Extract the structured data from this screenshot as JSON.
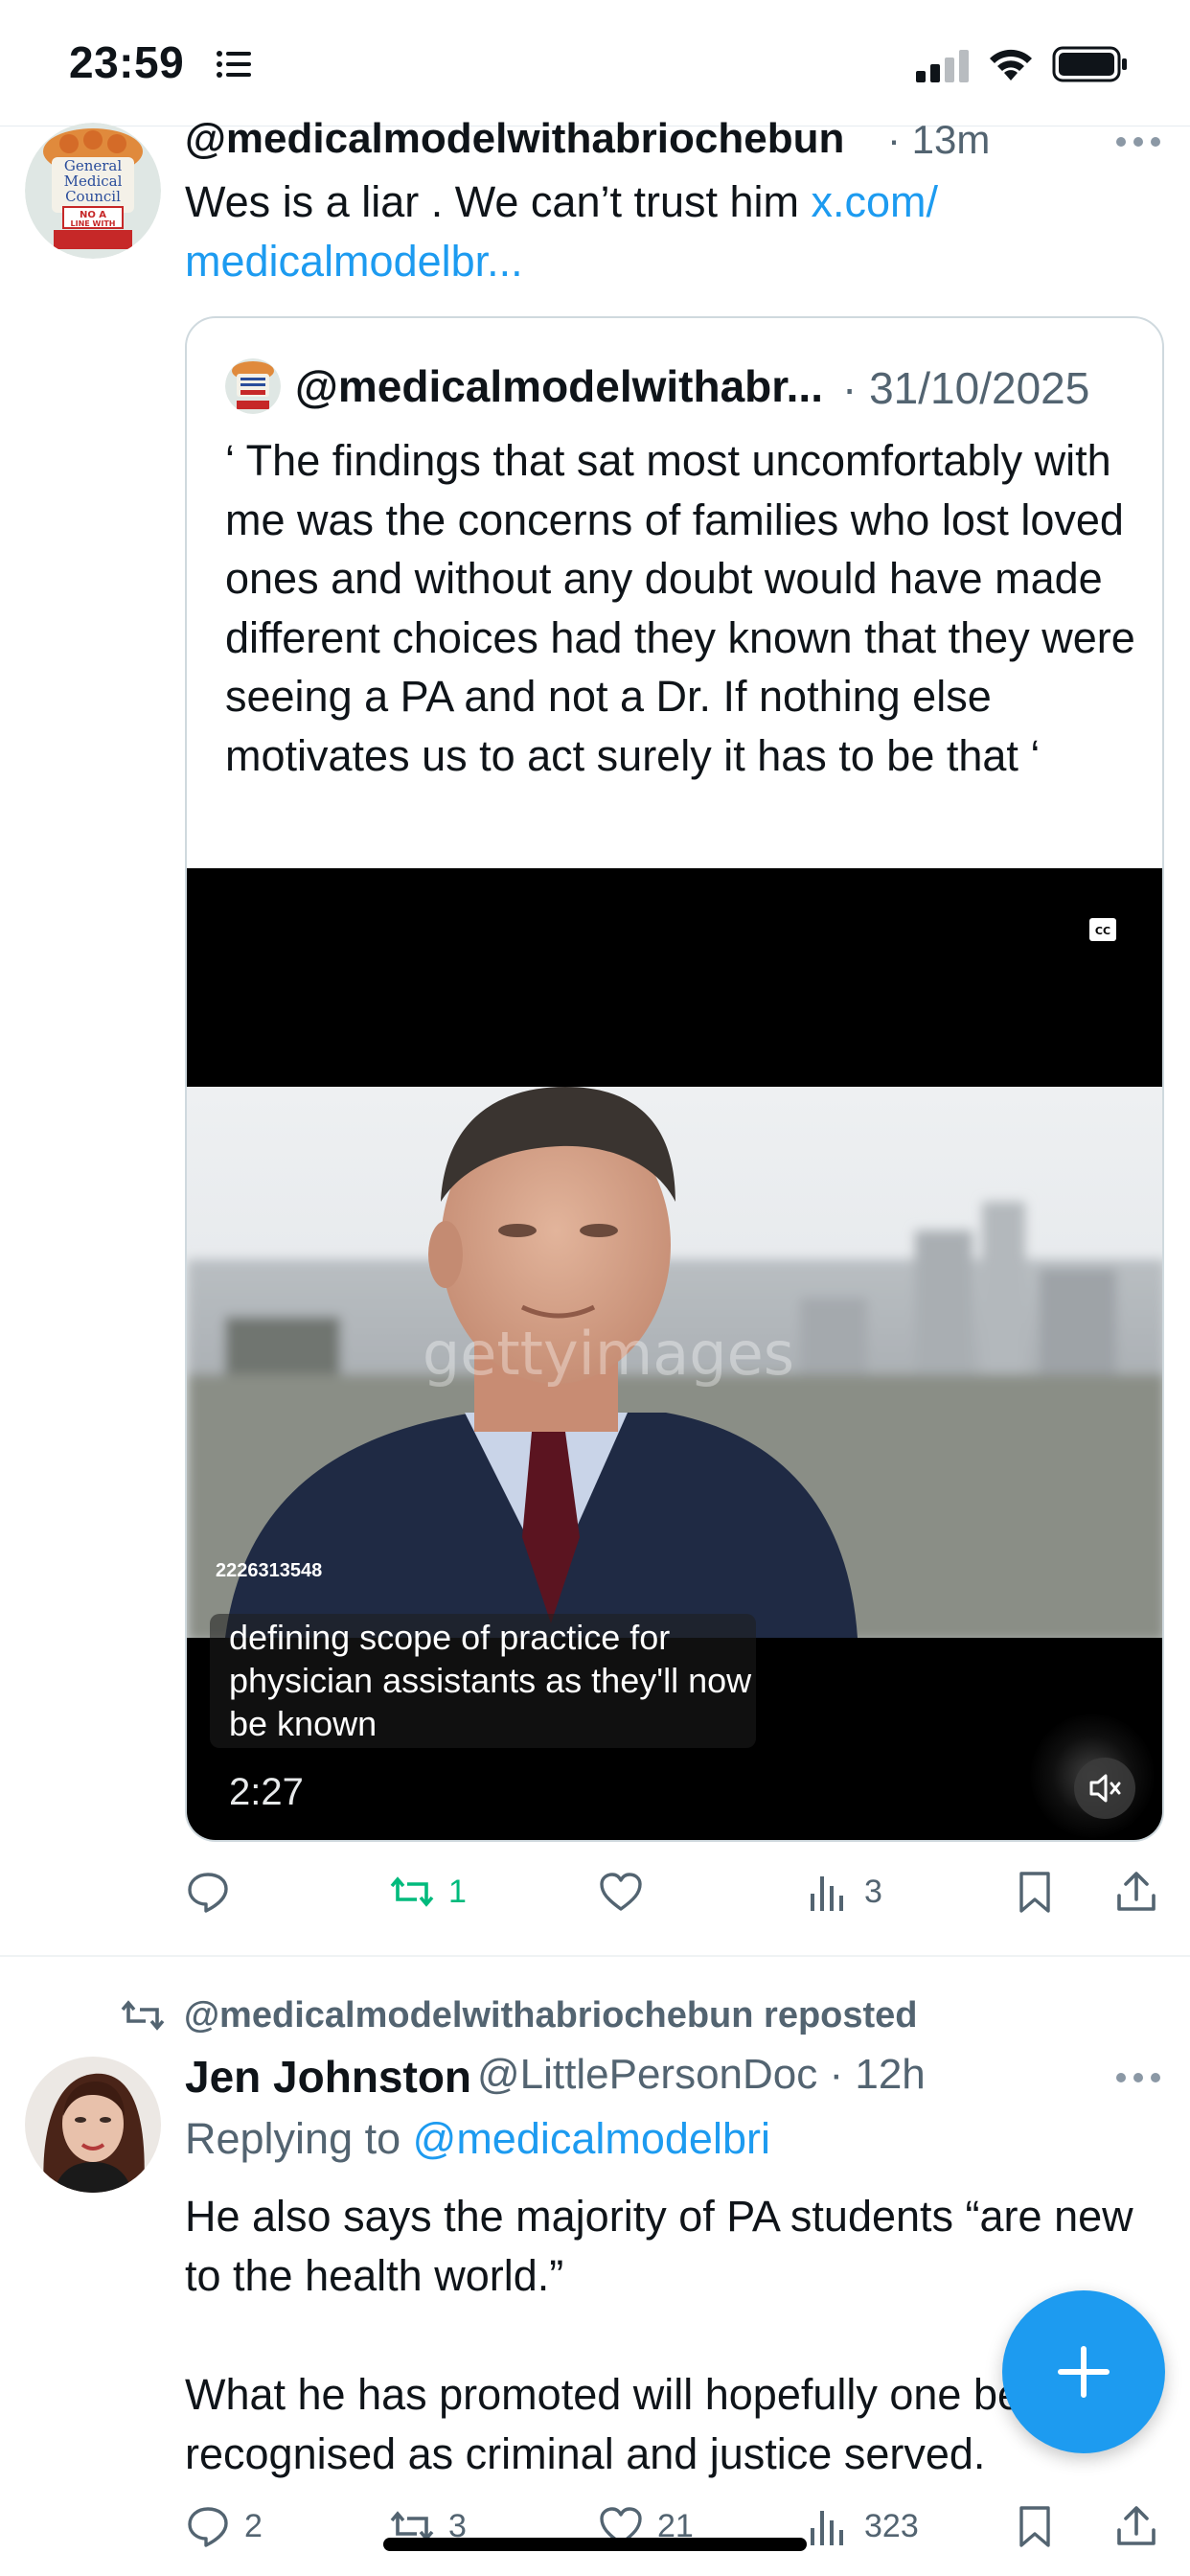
{
  "status_bar": {
    "time": "23:59"
  },
  "tweet1": {
    "handle": "@medicalmodelwithabriochebun",
    "time": "· 13m",
    "text": "Wes is a liar . We can’t trust him ",
    "link": "x.com/ medicalmodelbr...",
    "avatar_text": [
      "General",
      "Medical",
      "Council",
      "NO A",
      "LINE WITH"
    ],
    "quote": {
      "handle": "@medicalmodelwithabr...",
      "date": "· 31/10/2025",
      "text": "‘ The findings that sat most uncomfortably with me was the concerns of families who lost loved ones and without any doubt would have made different choices had they known that they were seeing a PA and not a Dr. If nothing else motivates us to act surely it has to be that ‘",
      "video": {
        "watermark": "gettyimages",
        "image_id": "2226313548",
        "caption": "defining scope of practice for physician assistants as they'll now be known",
        "duration": "2:27"
      }
    },
    "actions": {
      "reply": "",
      "repost": "1",
      "like": "",
      "views": "3"
    }
  },
  "tweet2": {
    "repost_label": "@medicalmodelwithabriochebun reposted",
    "name": "Jen Johnston",
    "handle": "@LittlePersonDoc · 12h",
    "replying_prefix": "Replying to ",
    "replying_to": "@medicalmodelbri",
    "paragraph1": "He also says the majority of PA students “are new to the health world.”",
    "paragraph2": "What he has promoted will hopefully one be recognised as criminal and justice served.",
    "actions": {
      "reply": "2",
      "repost": "3",
      "like": "21",
      "views": "323"
    }
  },
  "colors": {
    "accent": "#1d9bf0",
    "repost_green": "#00ba7c",
    "muted": "#536471",
    "text": "#0f1419"
  }
}
